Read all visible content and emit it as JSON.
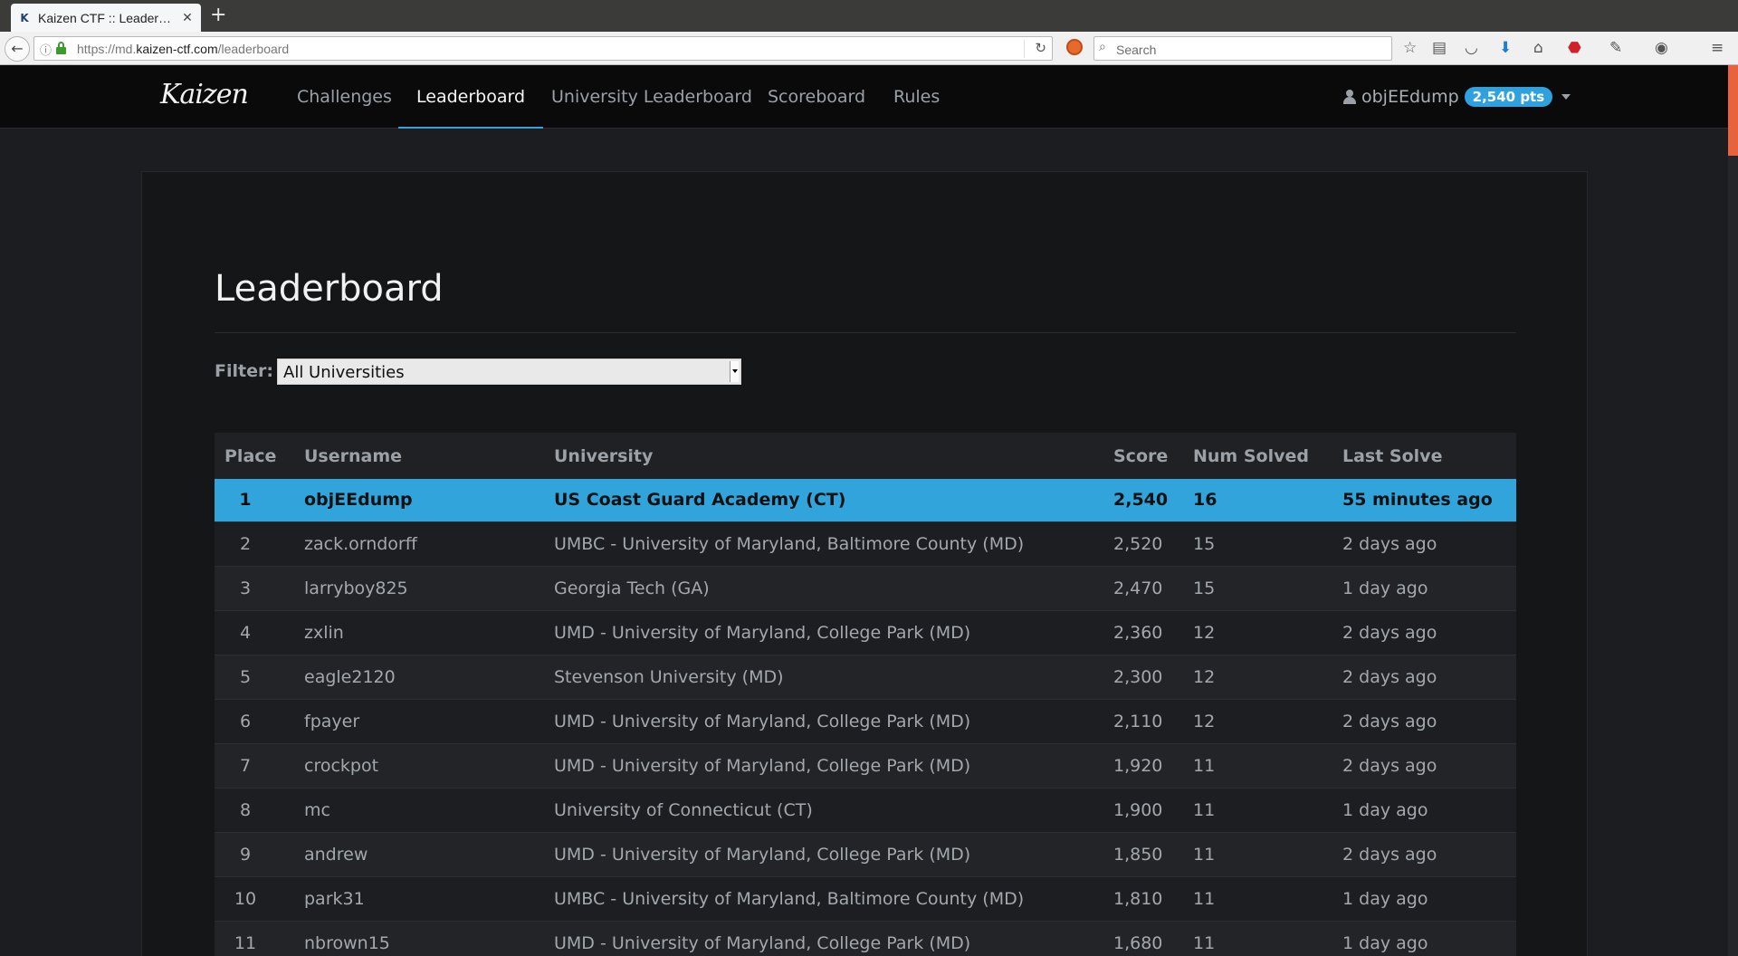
{
  "browser": {
    "tab_title": "Kaizen CTF :: Leader…",
    "url_prefix": "https://md.",
    "url_host": "kaizen-ctf.com",
    "url_path": "/leaderboard",
    "search_placeholder": "Search"
  },
  "site": {
    "logo_text": "Kaizen",
    "nav": [
      "Challenges",
      "Leaderboard",
      "University Leaderboard",
      "Scoreboard",
      "Rules"
    ],
    "active_nav": "Leaderboard",
    "username": "objEEdump",
    "points_badge": "2,540 pts"
  },
  "page": {
    "title": "Leaderboard",
    "filter_label": "Filter:",
    "filter_value": "All Universities"
  },
  "table": {
    "columns": [
      "Place",
      "Username",
      "University",
      "Score",
      "Num Solved",
      "Last Solve"
    ],
    "rows": [
      {
        "place": "1",
        "username": "objEEdump",
        "university": "US Coast Guard Academy (CT)",
        "score": "2,540",
        "solved": "16",
        "last": "55 minutes ago",
        "highlight": true
      },
      {
        "place": "2",
        "username": "zack.orndorff",
        "university": "UMBC - University of Maryland, Baltimore County (MD)",
        "score": "2,520",
        "solved": "15",
        "last": "2 days ago"
      },
      {
        "place": "3",
        "username": "larryboy825",
        "university": "Georgia Tech (GA)",
        "score": "2,470",
        "solved": "15",
        "last": "1 day ago"
      },
      {
        "place": "4",
        "username": "zxlin",
        "university": "UMD - University of Maryland, College Park (MD)",
        "score": "2,360",
        "solved": "12",
        "last": "2 days ago"
      },
      {
        "place": "5",
        "username": "eagle2120",
        "university": "Stevenson University (MD)",
        "score": "2,300",
        "solved": "12",
        "last": "2 days ago"
      },
      {
        "place": "6",
        "username": "fpayer",
        "university": "UMD - University of Maryland, College Park (MD)",
        "score": "2,110",
        "solved": "12",
        "last": "2 days ago"
      },
      {
        "place": "7",
        "username": "crockpot",
        "university": "UMD - University of Maryland, College Park (MD)",
        "score": "1,920",
        "solved": "11",
        "last": "2 days ago"
      },
      {
        "place": "8",
        "username": "mc",
        "university": "University of Connecticut (CT)",
        "score": "1,900",
        "solved": "11",
        "last": "1 day ago"
      },
      {
        "place": "9",
        "username": "andrew",
        "university": "UMD - University of Maryland, College Park (MD)",
        "score": "1,850",
        "solved": "11",
        "last": "2 days ago"
      },
      {
        "place": "10",
        "username": "park31",
        "university": "UMBC - University of Maryland, Baltimore County (MD)",
        "score": "1,810",
        "solved": "11",
        "last": "1 day ago"
      },
      {
        "place": "11",
        "username": "nbrown15",
        "university": "UMD - University of Maryland, College Park (MD)",
        "score": "1,680",
        "solved": "11",
        "last": "1 day ago"
      }
    ]
  },
  "colors": {
    "accent": "#31a5db",
    "header_bg": "#0a0a0b",
    "panel_bg": "#141618"
  }
}
